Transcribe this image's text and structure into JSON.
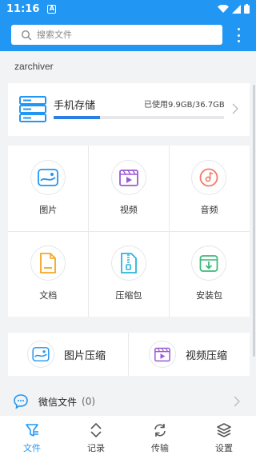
{
  "status_bar": {
    "time": "11:16",
    "notification_glyph": "A"
  },
  "search": {
    "placeholder": "搜索文件"
  },
  "section_title": "zarchiver",
  "storage": {
    "name": "手机存储",
    "usage_text": "已使用9.9GB/36.7GB",
    "used_fraction": 0.27
  },
  "categories": [
    {
      "label": "图片",
      "icon": "image-icon"
    },
    {
      "label": "视频",
      "icon": "video-icon"
    },
    {
      "label": "音频",
      "icon": "audio-icon"
    },
    {
      "label": "文档",
      "icon": "document-icon"
    },
    {
      "label": "压缩包",
      "icon": "archive-icon"
    },
    {
      "label": "安装包",
      "icon": "apk-icon"
    }
  ],
  "compress": [
    {
      "label": "图片压缩",
      "icon": "image-compress-icon"
    },
    {
      "label": "视频压缩",
      "icon": "video-compress-icon"
    }
  ],
  "wechat": {
    "label": "微信文件",
    "count": "(0)"
  },
  "bottom_nav": [
    {
      "label": "文件",
      "icon": "files-icon",
      "active": true
    },
    {
      "label": "记录",
      "icon": "history-icon",
      "active": false
    },
    {
      "label": "传输",
      "icon": "transfer-icon",
      "active": false
    },
    {
      "label": "设置",
      "icon": "settings-icon",
      "active": false
    }
  ],
  "colors": {
    "primary": "#2196f3",
    "accent_progress": "#2a7fe0",
    "image": "#2196f3",
    "video": "#9b59d6",
    "audio": "#f07a6a",
    "document": "#f5a623",
    "archive": "#29b6d8",
    "apk": "#3fb97a"
  }
}
